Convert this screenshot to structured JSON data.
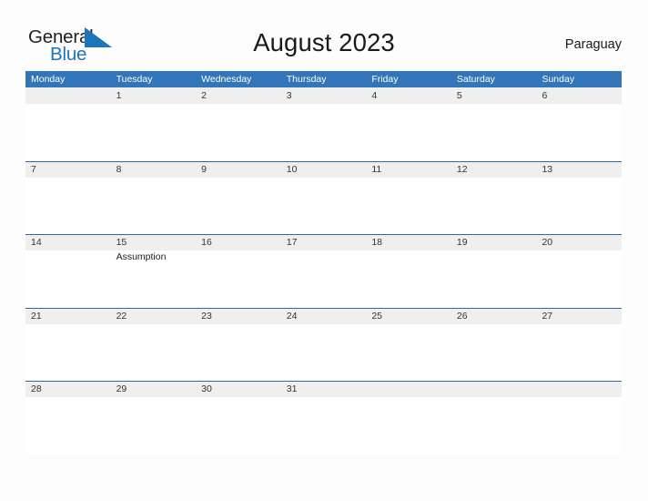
{
  "branding": {
    "logo_text_primary": "General",
    "logo_text_secondary": "Blue",
    "logo_mark": "triangle-flag-icon",
    "accent_color": "#1b75bb"
  },
  "header": {
    "title": "August 2023",
    "country": "Paraguay"
  },
  "colors": {
    "header_blue": "#3275b8",
    "row_line_blue": "#2b6ca8",
    "daynum_band_gray": "#efefef",
    "page_background": "#fdfdfd",
    "text_dark": "#1a1a1a"
  },
  "calendar": {
    "month": "August",
    "year": "2023",
    "weekday_headers": [
      "Monday",
      "Tuesday",
      "Wednesday",
      "Thursday",
      "Friday",
      "Saturday",
      "Sunday"
    ],
    "weeks": [
      [
        {
          "day": "",
          "events": []
        },
        {
          "day": "1",
          "events": []
        },
        {
          "day": "2",
          "events": []
        },
        {
          "day": "3",
          "events": []
        },
        {
          "day": "4",
          "events": []
        },
        {
          "day": "5",
          "events": []
        },
        {
          "day": "6",
          "events": []
        }
      ],
      [
        {
          "day": "7",
          "events": []
        },
        {
          "day": "8",
          "events": []
        },
        {
          "day": "9",
          "events": []
        },
        {
          "day": "10",
          "events": []
        },
        {
          "day": "11",
          "events": []
        },
        {
          "day": "12",
          "events": []
        },
        {
          "day": "13",
          "events": []
        }
      ],
      [
        {
          "day": "14",
          "events": []
        },
        {
          "day": "15",
          "events": [
            "Assumption"
          ]
        },
        {
          "day": "16",
          "events": []
        },
        {
          "day": "17",
          "events": []
        },
        {
          "day": "18",
          "events": []
        },
        {
          "day": "19",
          "events": []
        },
        {
          "day": "20",
          "events": []
        }
      ],
      [
        {
          "day": "21",
          "events": []
        },
        {
          "day": "22",
          "events": []
        },
        {
          "day": "23",
          "events": []
        },
        {
          "day": "24",
          "events": []
        },
        {
          "day": "25",
          "events": []
        },
        {
          "day": "26",
          "events": []
        },
        {
          "day": "27",
          "events": []
        }
      ],
      [
        {
          "day": "28",
          "events": []
        },
        {
          "day": "29",
          "events": []
        },
        {
          "day": "30",
          "events": []
        },
        {
          "day": "31",
          "events": []
        },
        {
          "day": "",
          "events": []
        },
        {
          "day": "",
          "events": []
        },
        {
          "day": "",
          "events": []
        }
      ]
    ]
  }
}
